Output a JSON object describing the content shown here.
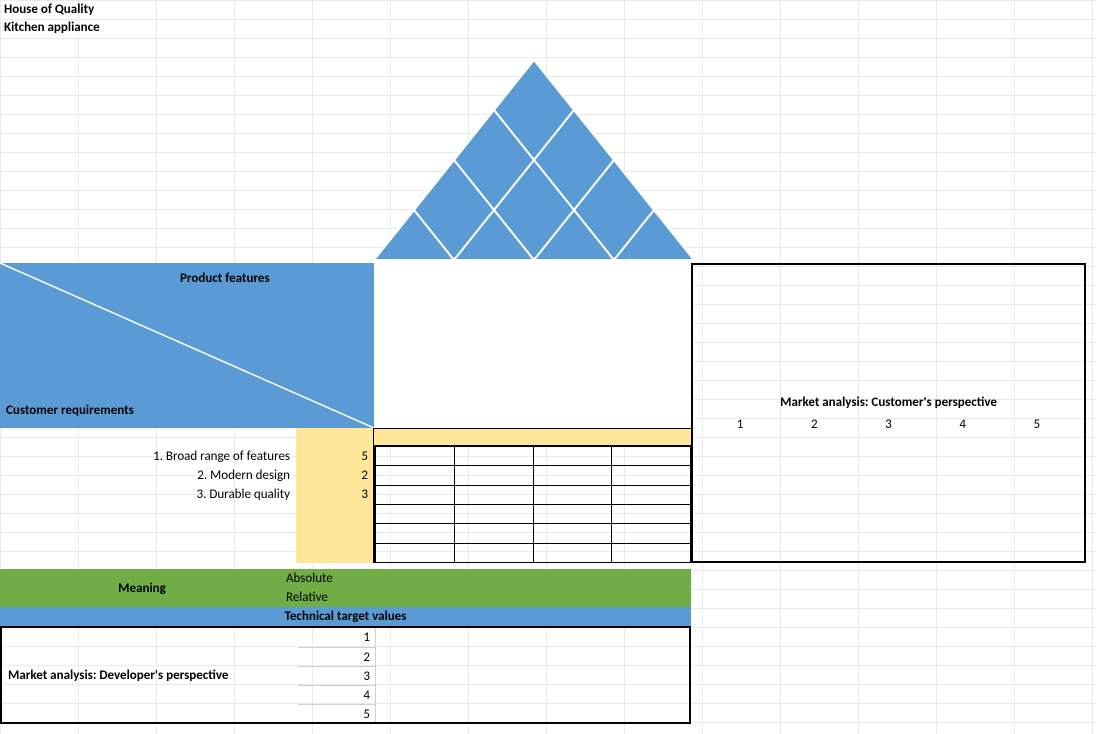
{
  "titles": {
    "line1": "House of Quality",
    "line2": "Kitchen appliance"
  },
  "headerBlock": {
    "productFeatures": "Product features",
    "customerRequirements": "Customer requirements"
  },
  "requirements": [
    {
      "label": "1. Broad range of features",
      "weight": "5"
    },
    {
      "label": "2. Modern design",
      "weight": "2"
    },
    {
      "label": "3. Durable quality",
      "weight": "3"
    }
  ],
  "marketAnalysis": {
    "title": "Market analysis: Customer's perspective",
    "scale": [
      "1",
      "2",
      "3",
      "4",
      "5"
    ]
  },
  "meaning": {
    "label": "Meaning",
    "absolute": "Absolute",
    "relative": "Relative"
  },
  "technicalTargets": "Technical target values",
  "developer": {
    "label": "Market analysis: Developer's perspective",
    "scale": [
      "1",
      "2",
      "3",
      "4",
      "5"
    ]
  }
}
